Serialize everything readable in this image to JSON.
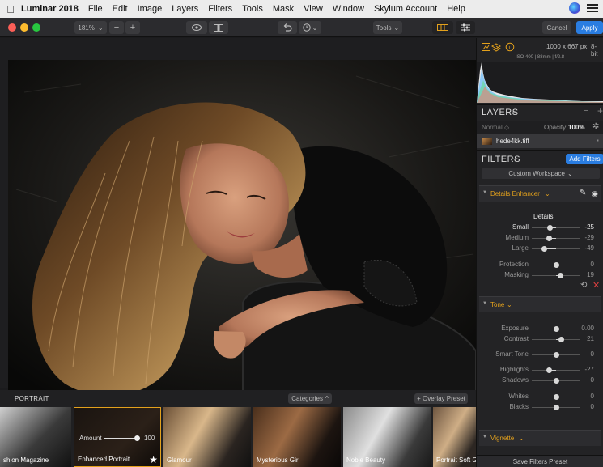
{
  "menubar": {
    "app_name": "Luminar 2018",
    "items": [
      "File",
      "Edit",
      "Image",
      "Layers",
      "Filters",
      "Tools",
      "Mask",
      "View",
      "Window",
      "Skylum Account",
      "Help"
    ]
  },
  "toolbar": {
    "zoom": "181%",
    "zoom_out": "−",
    "zoom_in": "+",
    "tools": "Tools",
    "cancel": "Cancel",
    "apply": "Apply"
  },
  "histogram": {
    "dimensions": "1000 x 667 px",
    "bit_depth": "8-bit",
    "exif": "ISO 400 | 88mm | f/2.8"
  },
  "layers": {
    "title": "LAYERS",
    "blend_mode": "Normal",
    "opacity_label": "Opacity:",
    "opacity_value": "100%",
    "layer_name": "hede4kk.tiff"
  },
  "filters": {
    "title": "FILTERS",
    "add_button": "Add Filters",
    "workspace": "Custom Workspace",
    "details_enhancer": {
      "title": "Details Enhancer",
      "section": "Details",
      "sliders": [
        {
          "label": "Small",
          "value": "-25",
          "level": -0.25
        },
        {
          "label": "Medium",
          "value": "-29",
          "level": -0.29
        },
        {
          "label": "Large",
          "value": "-49",
          "level": -0.49
        },
        {
          "label": "Protection",
          "value": "0",
          "level": 0
        },
        {
          "label": "Masking",
          "value": "19",
          "level": 0.19
        }
      ]
    },
    "tone": {
      "title": "Tone",
      "sliders": [
        {
          "label": "Exposure",
          "value": "0.00",
          "level": 0
        },
        {
          "label": "Contrast",
          "value": "21",
          "level": 0.21
        },
        {
          "label": "Smart Tone",
          "value": "0",
          "level": 0
        },
        {
          "label": "Highlights",
          "value": "-27",
          "level": -0.27
        },
        {
          "label": "Shadows",
          "value": "0",
          "level": 0
        },
        {
          "label": "Whites",
          "value": "0",
          "level": 0
        },
        {
          "label": "Blacks",
          "value": "0",
          "level": 0
        }
      ]
    },
    "vignette": {
      "title": "Vignette"
    },
    "save_preset": "Save Filters Preset"
  },
  "strip": {
    "title": "PORTRAIT",
    "categories": "Categories",
    "overlay": "+ Overlay Preset",
    "amount_label": "Amount",
    "amount_value": "100",
    "amount_level": 1,
    "presets": [
      "shion Magazine",
      "Enhanced Portrait",
      "Glamour",
      "Mysterious Girl",
      "Noble Beauty",
      "Portrait Soft G"
    ]
  },
  "colors": {
    "accent_blue": "#2a7de1",
    "accent_orange": "#e3a11c",
    "panel_bg": "#232325"
  }
}
